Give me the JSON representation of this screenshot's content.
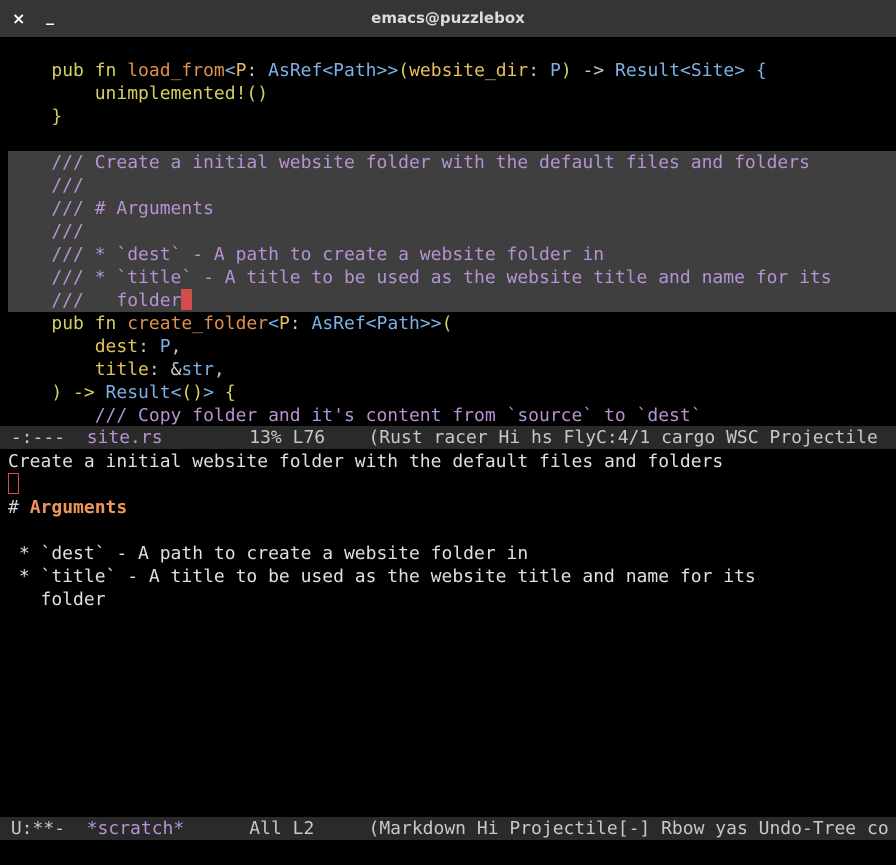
{
  "window": {
    "title": "emacs@puzzlebox",
    "close_glyph": "×",
    "minimize_glyph": "_"
  },
  "editor": {
    "line_1": {
      "indent": "    ",
      "kw": "pub fn ",
      "name": "load_from",
      "p1": "<",
      "gen": "P",
      "p2": ": ",
      "asref": "AsRef",
      "p3": "<",
      "path": "Path",
      "p4": ">>",
      "p5": "(",
      "arg": "website_dir",
      "p6": ": ",
      "argt": "P",
      "p7": ")",
      "p8": " -> ",
      "ret": "Result",
      "p9": "<",
      "site": "Site",
      "p10": ">",
      "p11": " {"
    },
    "line_2": {
      "indent": "        ",
      "mac": "unimplemented!",
      "p1": "()"
    },
    "line_3": {
      "indent": "    ",
      "brace": "}"
    },
    "doc_lines": [
      "    /// Create a initial website folder with the default files and folders",
      "    ///",
      "    /// # Arguments",
      "    ///",
      "    /// * `dest` - A path to create a website folder in",
      "    /// * `title` - A title to be used as the website title and name for its",
      "    ///   folder"
    ],
    "line_11": {
      "indent": "    ",
      "kw": "pub fn ",
      "name": "create_folder",
      "p1": "<",
      "gen": "P",
      "p2": ": ",
      "asref": "AsRef",
      "p3": "<",
      "path": "Path",
      "p4": ">>",
      "p5": "("
    },
    "line_12": {
      "indent": "        ",
      "arg": "dest",
      "p1": ": ",
      "argt": "P",
      "p2": ","
    },
    "line_13": {
      "indent": "        ",
      "arg": "title",
      "p1": ": &",
      "argt": "str",
      "p2": ","
    },
    "line_14": {
      "indent": "    ",
      "p1": ") -> ",
      "ret": "Result",
      "p2": "<",
      "p3": "()",
      "p4": ">",
      "p5": " {"
    },
    "line_15": "        /// Copy folder and it's content from `source` to `dest`"
  },
  "modeline_top": {
    "status": " -:---  ",
    "buffer": "site.rs",
    "position": "        13% L76    ",
    "modes": "(Rust racer Hi hs FlyC:4/1 cargo WSC Projectile"
  },
  "scratch": {
    "line_1": "Create a initial website folder with the default files and folders",
    "header_hash": "# ",
    "header_text": "Arguments",
    "bullet_1": " * `dest` - A path to create a website folder in",
    "bullet_2": " * `title` - A title to be used as the website title and name for its",
    "bullet_3": "   folder"
  },
  "modeline_bottom": {
    "status": " U:**-  ",
    "buffer": "*scratch*",
    "position": "      All L2     ",
    "modes": "(Markdown Hi Projectile[-] Rbow yas Undo-Tree co"
  }
}
